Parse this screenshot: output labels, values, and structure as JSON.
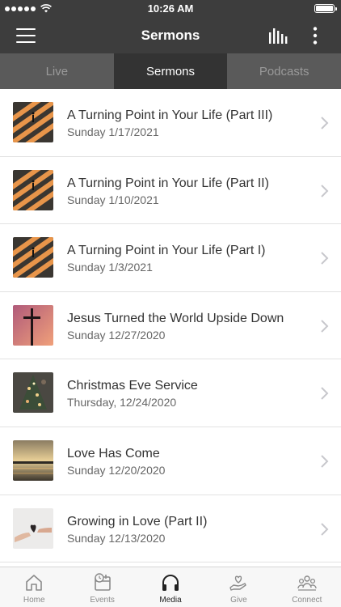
{
  "status_bar": {
    "time": "10:26 AM"
  },
  "nav": {
    "title": "Sermons"
  },
  "tabs": [
    {
      "label": "Live",
      "active": false
    },
    {
      "label": "Sermons",
      "active": true
    },
    {
      "label": "Podcasts",
      "active": false
    }
  ],
  "sermons": [
    {
      "title": "A Turning Point in Your Life (Part III)",
      "date": "Sunday 1/17/2021",
      "thumb": "crosswalk-icon"
    },
    {
      "title": "A Turning Point in Your Life (Part II)",
      "date": "Sunday 1/10/2021",
      "thumb": "crosswalk-icon"
    },
    {
      "title": "A Turning Point in Your Life (Part I)",
      "date": "Sunday 1/3/2021",
      "thumb": "crosswalk-icon"
    },
    {
      "title": "Jesus Turned the World Upside Down",
      "date": "Sunday 12/27/2020",
      "thumb": "cross-sunset-icon"
    },
    {
      "title": "Christmas Eve Service",
      "date": "Thursday, 12/24/2020",
      "thumb": "christmas-tree-icon"
    },
    {
      "title": "Love Has Come",
      "date": "Sunday 12/20/2020",
      "thumb": "lake-sunset-icon"
    },
    {
      "title": "Growing in Love (Part II)",
      "date": "Sunday 12/13/2020",
      "thumb": "heart-hands-icon"
    }
  ],
  "tab_bar": [
    {
      "label": "Home",
      "icon": "home-icon",
      "active": false
    },
    {
      "label": "Events",
      "icon": "calendar-clock-icon",
      "active": false
    },
    {
      "label": "Media",
      "icon": "headphones-icon",
      "active": true
    },
    {
      "label": "Give",
      "icon": "give-hand-heart-icon",
      "active": false
    },
    {
      "label": "Connect",
      "icon": "people-group-icon",
      "active": false
    }
  ],
  "colors": {
    "header": "#3d3d3d",
    "tabs_bg": "#5a5a5a",
    "tab_active": "#333333"
  }
}
